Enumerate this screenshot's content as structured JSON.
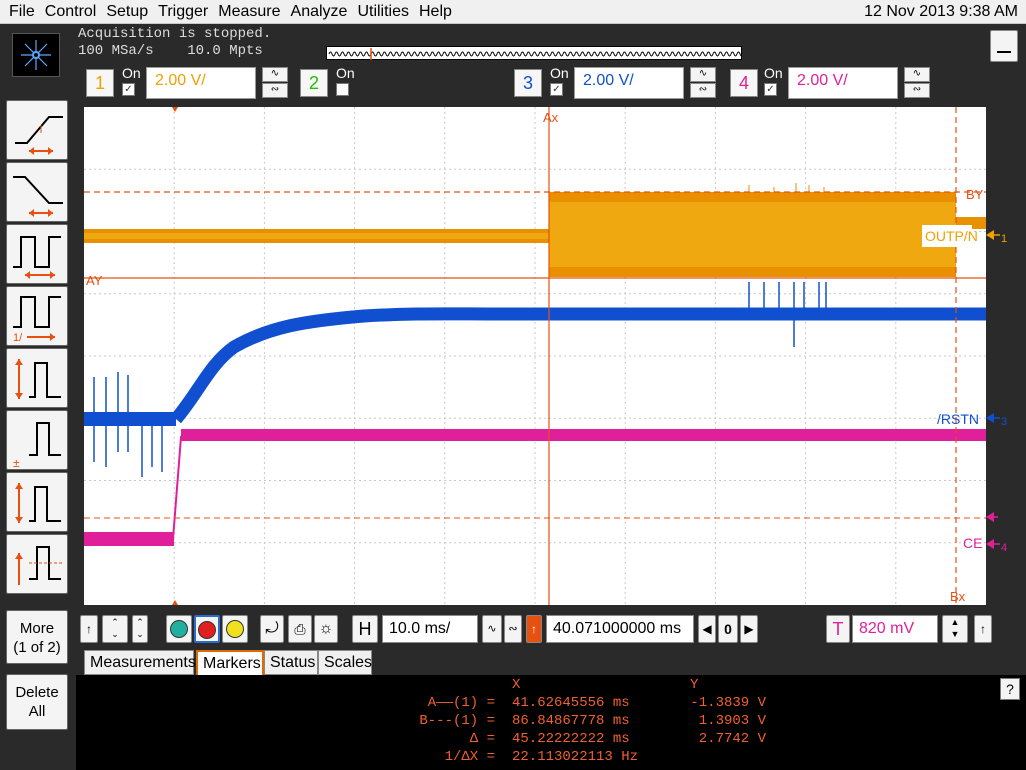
{
  "menu": [
    "File",
    "Control",
    "Setup",
    "Trigger",
    "Measure",
    "Analyze",
    "Utilities",
    "Help"
  ],
  "datetime": "12 Nov 2013  9:38 AM",
  "acquisition": {
    "status": "Acquisition is stopped.",
    "rate": "100 MSa/s    10.0 Mpts"
  },
  "channels": [
    {
      "num": "1",
      "on_label": "On",
      "checked": true,
      "scale": "2.00 V/",
      "color": "#f0a000"
    },
    {
      "num": "2",
      "on_label": "On",
      "checked": false,
      "scale": "",
      "color": "#22c000"
    },
    {
      "num": "3",
      "on_label": "On",
      "checked": true,
      "scale": "2.00 V/",
      "color": "#1050d0"
    },
    {
      "num": "4",
      "on_label": "On",
      "checked": true,
      "scale": "2.00 V/",
      "color": "#e0209a"
    }
  ],
  "sidebar": {
    "more_label": "More\n(1 of 2)",
    "delete_label": "Delete\nAll"
  },
  "markers": {
    "ax": "Ax",
    "ay": "AY",
    "by": "BY",
    "bx": "Bx"
  },
  "waveform_labels": {
    "ch1": "OUTP/N",
    "ch3": "/RSTN",
    "ch4": "CE",
    "trigger": "T"
  },
  "controls": {
    "h_label": "H",
    "timebase": "10.0 ms/",
    "delay": "40.071000000 ms",
    "zoom_value": "0",
    "t_label": "T",
    "trigger_level": "820 mV"
  },
  "tabs": [
    "Measurements",
    "Markers",
    "Status",
    "Scales"
  ],
  "active_tab": "Markers",
  "marker_table": {
    "header_x": "X",
    "header_y": "Y",
    "rows": [
      {
        "label": "A——(1) =",
        "x": "41.62645556 ms",
        "y": "-1.3839 V"
      },
      {
        "label": "B---(1) =",
        "x": "86.84867778 ms",
        "y": "1.3903 V"
      },
      {
        "label": "Δ =",
        "x": "45.22222222 ms",
        "y": "2.7742 V"
      },
      {
        "label": "1/ΔX =",
        "x": "22.113022113 Hz",
        "y": ""
      }
    ]
  },
  "help_label": "?",
  "colors": {
    "ch1": "#f0a000",
    "ch3": "#1050d0",
    "ch4": "#e0209a",
    "marker": "#e85010"
  }
}
